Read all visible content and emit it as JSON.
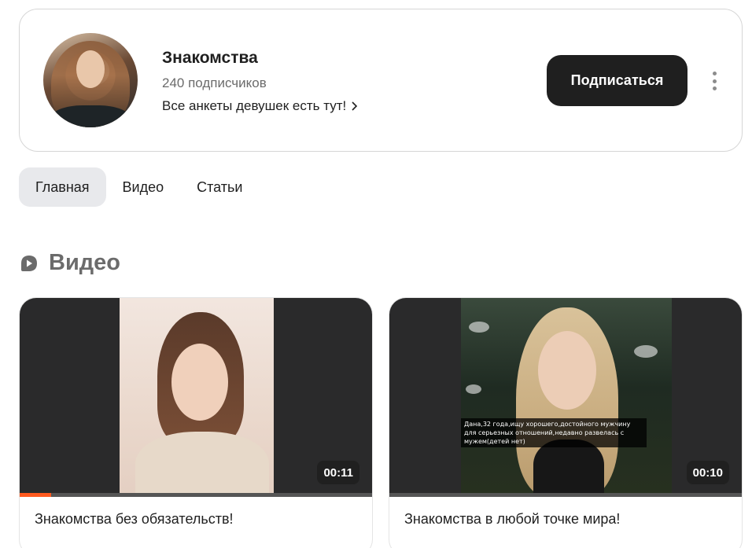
{
  "channel": {
    "title": "Знакомства",
    "subscribers": "240 подписчиков",
    "description": "Все анкеты девушек есть тут!",
    "subscribe_label": "Подписаться"
  },
  "tabs": [
    {
      "label": "Главная",
      "active": true
    },
    {
      "label": "Видео",
      "active": false
    },
    {
      "label": "Статьи",
      "active": false
    }
  ],
  "section": {
    "title": "Видео",
    "icon": "play-icon"
  },
  "videos": [
    {
      "title": "Знакомства без обязательств!",
      "duration": "00:11",
      "progress": 0.09,
      "caption": ""
    },
    {
      "title": "Знакомства в любой точке мира!",
      "duration": "00:10",
      "progress": 0,
      "caption": "Дана,32 года,ищу хорошего,достойного мужчину для серьезных отношений,недавно развелась с мужем(детей нет)"
    }
  ],
  "colors": {
    "accent_dark": "#1f1f1f",
    "progress": "#ff5a1f",
    "tab_active_bg": "#e8e9ec"
  }
}
